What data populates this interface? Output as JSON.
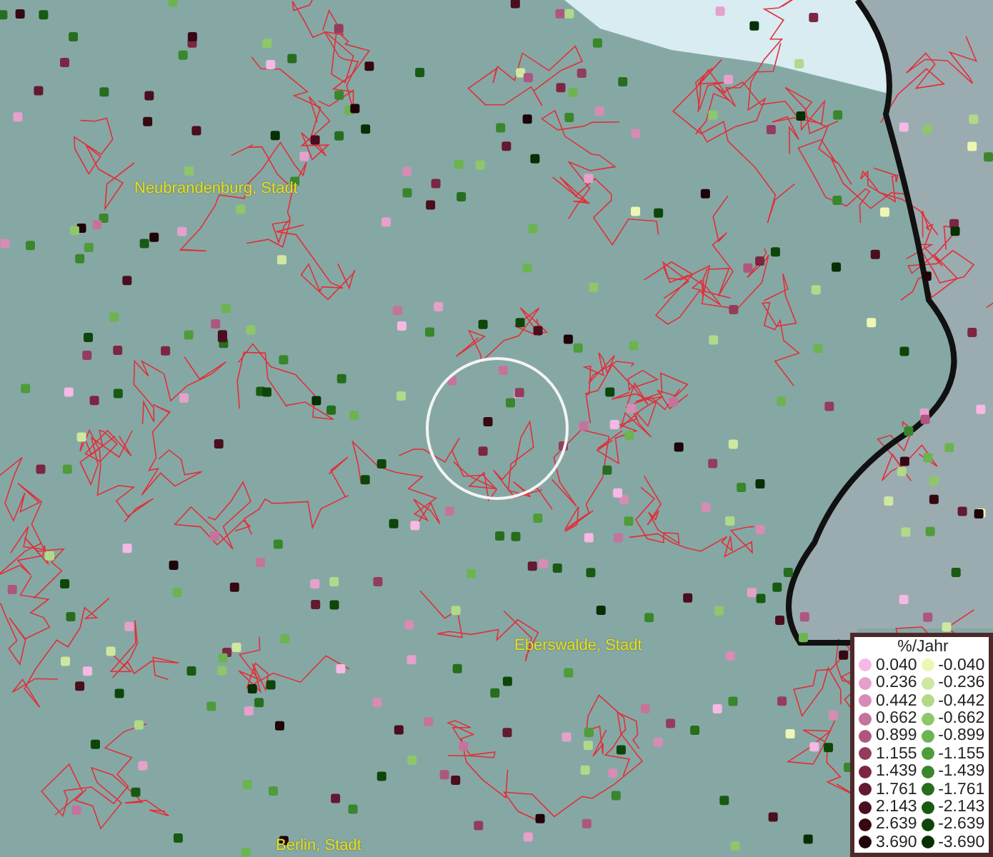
{
  "map": {
    "places": [
      {
        "name": "Neubrandenburg, Stadt"
      },
      {
        "name": "Eberswalde, Stadt"
      },
      {
        "name": "Berlin, Stadt"
      }
    ]
  },
  "legend": {
    "title": "%/Jahr",
    "positive": [
      {
        "value": "0.040",
        "color": "#f6b8e4"
      },
      {
        "value": "0.236",
        "color": "#e6a0cc"
      },
      {
        "value": "0.442",
        "color": "#d68cb4"
      },
      {
        "value": "0.662",
        "color": "#c4749c"
      },
      {
        "value": "0.899",
        "color": "#ac5680"
      },
      {
        "value": "1.155",
        "color": "#943c5e"
      },
      {
        "value": "1.439",
        "color": "#7c2644"
      },
      {
        "value": "1.761",
        "color": "#621a30"
      },
      {
        "value": "2.143",
        "color": "#4a0e1e"
      },
      {
        "value": "2.639",
        "color": "#360812"
      },
      {
        "value": "3.690",
        "color": "#1e0408"
      }
    ],
    "negative": [
      {
        "value": "-0.040",
        "color": "#eef6b4"
      },
      {
        "value": "-0.236",
        "color": "#cee8a0"
      },
      {
        "value": "-0.442",
        "color": "#b0da88"
      },
      {
        "value": "-0.662",
        "color": "#8ec66a"
      },
      {
        "value": "-0.899",
        "color": "#6cb450"
      },
      {
        "value": "-1.155",
        "color": "#4e9c3a"
      },
      {
        "value": "-1.439",
        "color": "#3a862c"
      },
      {
        "value": "-1.761",
        "color": "#266e1e"
      },
      {
        "value": "-2.143",
        "color": "#185a12"
      },
      {
        "value": "-2.639",
        "color": "#0e460a"
      },
      {
        "value": "-3.690",
        "color": "#063004"
      }
    ]
  }
}
